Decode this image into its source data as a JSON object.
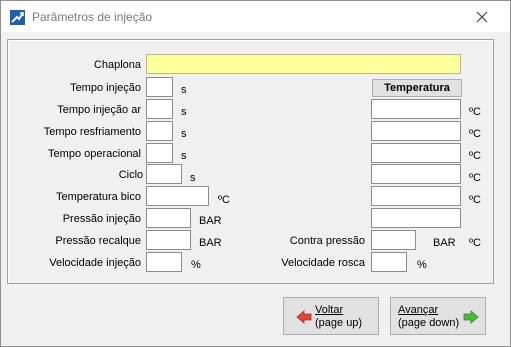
{
  "window": {
    "title": "Parâmetros de injeção"
  },
  "form": {
    "chaplona_label": "Chaplona",
    "chaplona_value": "",
    "tempo_injecao_label": "Tempo injeção",
    "tempo_injecao_ar_label": "Tempo injeção ar",
    "tempo_resfriamento_label": "Tempo resfriamento",
    "tempo_operacional_label": "Tempo operacional",
    "ciclo_total_label": "Ciclo total",
    "temperatura_bico_label": "Temperatura bico",
    "pressao_injecao_label": "Pressão injeção",
    "pressao_recalque_label": "Pressão recalque",
    "velocidade_injecao_label": "Velocidade injeção",
    "contra_pressao_label": "Contra pressão",
    "velocidade_rosca_label": "Velocidade rosca",
    "unit_seconds": "s",
    "unit_celsius": "ºC",
    "unit_bar": "BAR",
    "unit_percent": "%",
    "temperatura_button": "Temperatura"
  },
  "footer": {
    "back_label": "Voltar",
    "back_hint": "(page up)",
    "next_label": "Avançar",
    "next_hint": "(page down)"
  },
  "colors": {
    "highlight_field": "#ffff9c",
    "back_arrow": "#e0443a",
    "next_arrow": "#4cbb3c"
  }
}
